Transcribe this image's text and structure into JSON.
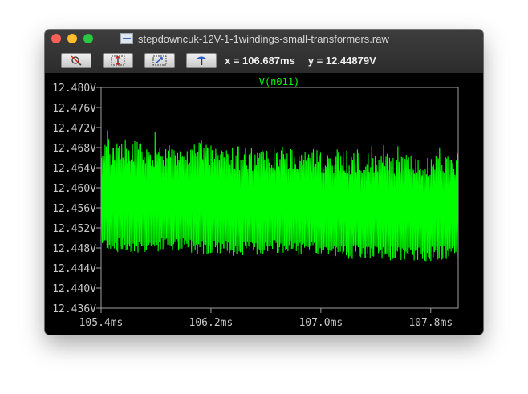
{
  "window": {
    "title": "stepdowncuk-12V-1-1windings-small-transformers.raw"
  },
  "toolbar": {
    "buttons": [
      {
        "icon": "zoom-cancel-icon"
      },
      {
        "icon": "autoscale-icon"
      },
      {
        "icon": "zoom-out-icon"
      },
      {
        "icon": "hammer-icon"
      }
    ],
    "x_readout": "x = 106.687ms",
    "y_readout": "y = 12.44879V"
  },
  "colors": {
    "trace": "#00ff00",
    "axis": "#a0a0a0",
    "tick_label": "#c8c8c8",
    "background": "#000000"
  },
  "chart_data": {
    "type": "line",
    "series": [
      {
        "name": "V(n011)",
        "color": "#00ff00",
        "x_range_ms": [
          105.4,
          108.0
        ],
        "y_upper_envelope": [
          12.4685,
          12.47,
          12.4695,
          12.469,
          12.4685,
          12.469,
          12.4695,
          12.469,
          12.4685,
          12.468,
          12.468,
          12.4682,
          12.468,
          12.4678,
          12.4675,
          12.4672,
          12.467,
          12.4668,
          12.4668,
          12.4665,
          12.4665,
          12.4668,
          12.467
        ],
        "y_lower_envelope": [
          12.4485,
          12.4478,
          12.4476,
          12.4478,
          12.448,
          12.4478,
          12.4476,
          12.4475,
          12.4472,
          12.4472,
          12.4473,
          12.4475,
          12.4473,
          12.447,
          12.4468,
          12.4466,
          12.4464,
          12.4462,
          12.4462,
          12.446,
          12.446,
          12.4463,
          12.4468
        ]
      }
    ],
    "xticks": [
      "105.4ms",
      "106.2ms",
      "107.0ms",
      "107.8ms"
    ],
    "xtick_values": [
      105.4,
      106.2,
      107.0,
      107.8
    ],
    "yticks": [
      "12.480V",
      "12.476V",
      "12.472V",
      "12.468V",
      "12.464V",
      "12.460V",
      "12.456V",
      "12.452V",
      "12.448V",
      "12.444V",
      "12.440V",
      "12.436V"
    ],
    "ytick_values": [
      12.48,
      12.476,
      12.472,
      12.468,
      12.464,
      12.46,
      12.456,
      12.452,
      12.448,
      12.444,
      12.44,
      12.436
    ],
    "xlim": [
      105.4,
      108.0
    ],
    "ylim": [
      12.436,
      12.48
    ],
    "grid": false
  }
}
